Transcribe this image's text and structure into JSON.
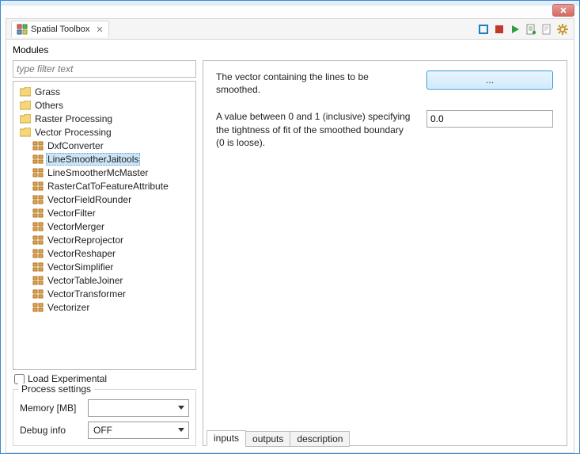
{
  "window": {
    "tab_title": "Spatial Toolbox"
  },
  "toolbar": {
    "stop_icon": "stop",
    "stop2_icon": "stop-red",
    "run_icon": "run",
    "script_icon": "script",
    "page_icon": "page",
    "gear_icon": "gear"
  },
  "modules": {
    "section_label": "Modules",
    "filter_placeholder": "type filter text",
    "tree": {
      "grass": "Grass",
      "others": "Others",
      "raster": "Raster Processing",
      "vector": "Vector Processing",
      "vector_children": [
        "DxfConverter",
        "LineSmootherJaitools",
        "LineSmootherMcMaster",
        "RasterCatToFeatureAttribute",
        "VectorFieldRounder",
        "VectorFilter",
        "VectorMerger",
        "VectorReprojector",
        "VectorReshaper",
        "VectorSimplifier",
        "VectorTableJoiner",
        "VectorTransformer",
        "Vectorizer"
      ],
      "selected_index": 1
    },
    "load_experimental": "Load Experimental"
  },
  "process_settings": {
    "legend": "Process settings",
    "memory_label": "Memory [MB]",
    "memory_value": "",
    "debug_label": "Debug info",
    "debug_value": "OFF"
  },
  "params": {
    "p1_desc": "The vector containing the lines to be smoothed.",
    "p1_button": "...",
    "p2_desc": "A value between 0 and 1 (inclusive) specifying the tightness of fit of the smoothed boundary (0 is loose).",
    "p2_value": "0.0"
  },
  "tabs": {
    "t1": "inputs",
    "t2": "outputs",
    "t3": "description"
  }
}
